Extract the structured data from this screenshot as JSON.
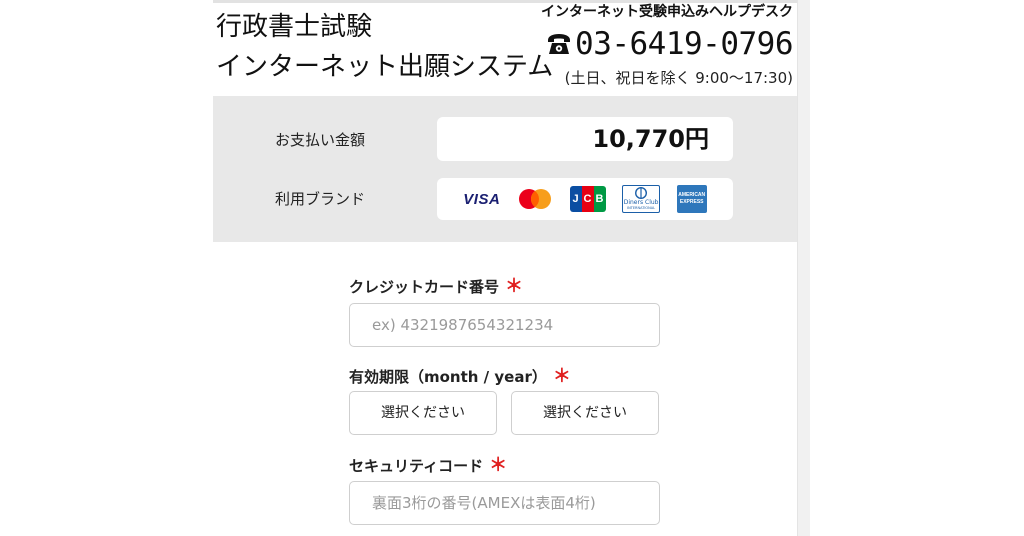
{
  "header": {
    "title_line1": "行政書士試験",
    "title_line2": "インターネット出願システム",
    "helpdesk_label": "インターネット受験申込みヘルプデスク",
    "phone_number": "03-6419-0796",
    "hours": "(土日、祝日を除く 9:00〜17:30)"
  },
  "payment": {
    "amount_label": "お支払い金額",
    "amount": "10,770円",
    "brand_label": "利用ブランド",
    "brands": [
      "VISA",
      "Mastercard",
      "JCB",
      "Diners Club",
      "AMERICAN EXPRESS"
    ],
    "brand_texts": {
      "visa": "VISA",
      "jcb": "JCB",
      "diners_top": "Diners Club",
      "diners_bottom": "INTERNATIONAL",
      "amex_top": "AMERICAN",
      "amex_bottom": "EXPRESS"
    }
  },
  "form": {
    "card_number_label": "クレジットカード番号",
    "card_number_placeholder": "ex) 4321987654321234",
    "expiry_label": "有効期限（month / year）",
    "expiry_month_value": "選択ください",
    "expiry_year_value": "選択ください",
    "security_label": "セキュリティコード",
    "security_placeholder": "裏面3桁の番号(AMEXは表面4桁)",
    "required_mark": "＊"
  },
  "colors": {
    "summary_bg": "#e8e8e8",
    "required": "#e02020",
    "visa_blue": "#1a1f71",
    "amex_blue": "#2e77bb",
    "jcb_blue": "#0b4ea2",
    "jcb_red": "#e60012",
    "jcb_green": "#009944"
  }
}
